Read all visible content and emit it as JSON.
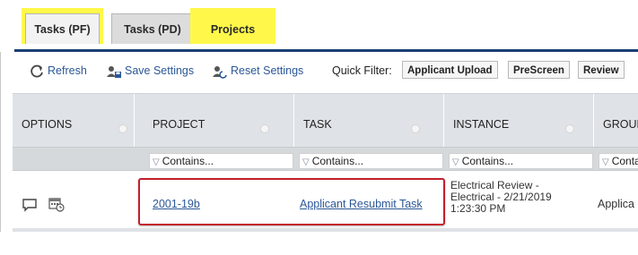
{
  "tabs": [
    {
      "label": "Tasks (PF)",
      "highlighted": true
    },
    {
      "label": "Tasks (PD)",
      "highlighted": false
    },
    {
      "label": "Projects",
      "highlighted": true
    }
  ],
  "toolbar": {
    "refresh_label": "Refresh",
    "save_settings_label": "Save Settings",
    "reset_settings_label": "Reset Settings",
    "quick_filter_label": "Quick Filter:",
    "quick_filters": [
      "Applicant Upload",
      "PreScreen",
      "Review"
    ]
  },
  "grid": {
    "columns": [
      "OPTIONS",
      "PROJECT",
      "TASK",
      "INSTANCE",
      "GROUP"
    ],
    "filter_placeholder": "Contains...",
    "rows": [
      {
        "project": "2001-19b",
        "task": "Applicant Resubmit Task",
        "instance": "Electrical Review - Electrical - 2/21/2019 1:23:30 PM",
        "group": "Applica"
      }
    ]
  },
  "icons": {
    "option_1": "comment-icon",
    "option_2": "calendar-icon",
    "refresh": "refresh-icon",
    "save": "save-settings-icon",
    "reset": "reset-settings-icon",
    "filter": "filter-icon"
  },
  "colors": {
    "highlight": "#fff84a",
    "link": "#2b5797",
    "tab_underline": "#1a3f73",
    "header_bg": "#dfe2e6",
    "annotation_box": "#c21f2c"
  }
}
